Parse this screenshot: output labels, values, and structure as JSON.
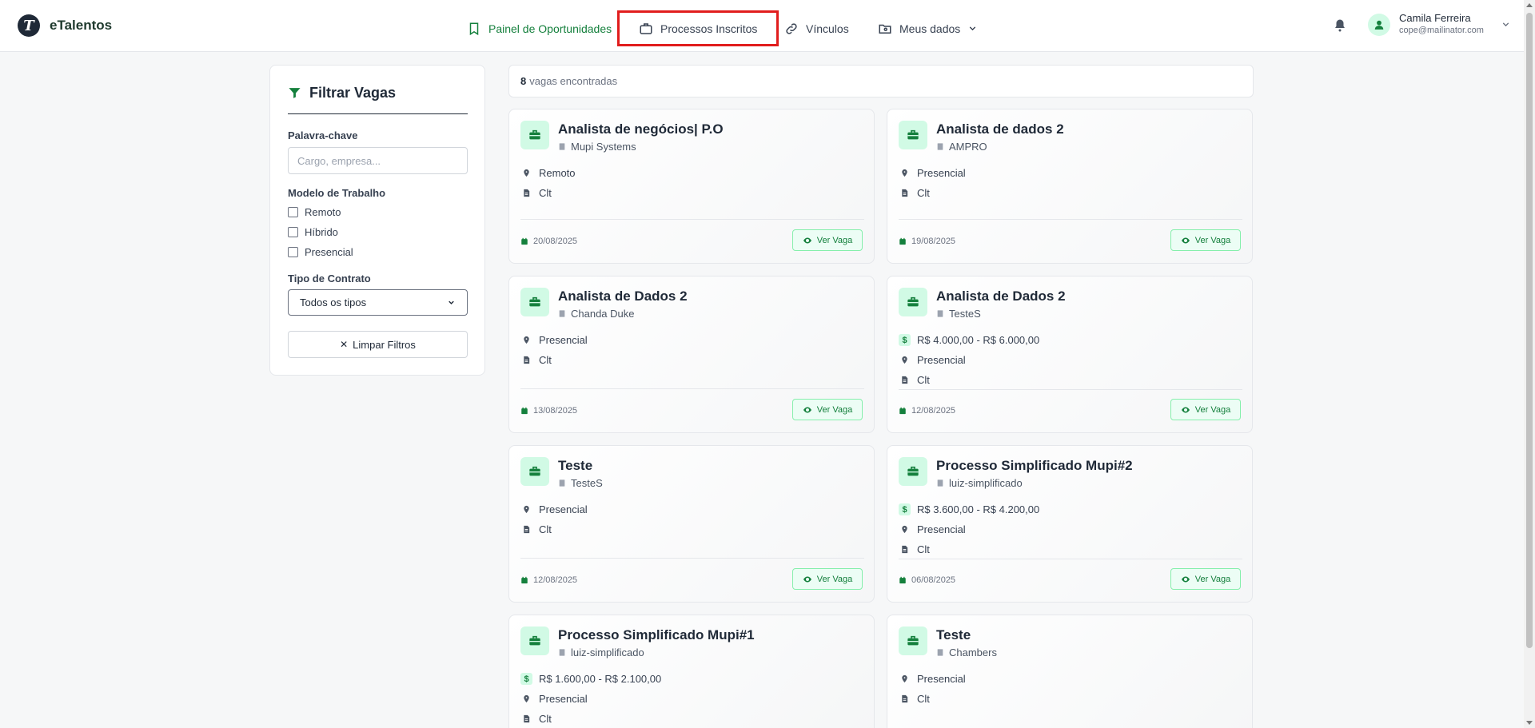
{
  "app": {
    "name": "eTalentos",
    "logo_letter": "T"
  },
  "nav": {
    "painel": "Painel de Oportunidades",
    "processos": "Processos Inscritos",
    "vinculos": "Vínculos",
    "meus_dados": "Meus dados"
  },
  "user": {
    "name": "Camila Ferreira",
    "email": "cope@mailinator.com"
  },
  "filter": {
    "title": "Filtrar Vagas",
    "keyword_label": "Palavra-chave",
    "keyword_placeholder": "Cargo, empresa...",
    "work_model_label": "Modelo de Trabalho",
    "work_models": [
      "Remoto",
      "Híbrido",
      "Presencial"
    ],
    "contract_label": "Tipo de Contrato",
    "contract_selected": "Todos os tipos",
    "clear_label": "Limpar Filtros"
  },
  "results": {
    "count": "8",
    "count_suffix": "vagas encontradas"
  },
  "jobs": [
    {
      "title": "Analista de negócios| P.O",
      "company": "Mupi Systems",
      "salary": "",
      "model": "Remoto",
      "contract": "Clt",
      "date": "20/08/2025",
      "button": "Ver Vaga"
    },
    {
      "title": "Analista de dados 2",
      "company": "AMPRO",
      "salary": "",
      "model": "Presencial",
      "contract": "Clt",
      "date": "19/08/2025",
      "button": "Ver Vaga"
    },
    {
      "title": "Analista de Dados 2",
      "company": "Chanda Duke",
      "salary": "",
      "model": "Presencial",
      "contract": "Clt",
      "date": "13/08/2025",
      "button": "Ver Vaga"
    },
    {
      "title": "Analista de Dados 2",
      "company": "TesteS",
      "salary": "R$ 4.000,00 - R$ 6.000,00",
      "model": "Presencial",
      "contract": "Clt",
      "date": "12/08/2025",
      "button": "Ver Vaga"
    },
    {
      "title": "Teste",
      "company": "TesteS",
      "salary": "",
      "model": "Presencial",
      "contract": "Clt",
      "date": "12/08/2025",
      "button": "Ver Vaga"
    },
    {
      "title": "Processo Simplificado Mupi#2",
      "company": "luiz-simplificado",
      "salary": "R$ 3.600,00 - R$ 4.200,00",
      "model": "Presencial",
      "contract": "Clt",
      "date": "06/08/2025",
      "button": "Ver Vaga"
    },
    {
      "title": "Processo Simplificado Mupi#1",
      "company": "luiz-simplificado",
      "salary": "R$ 1.600,00 - R$ 2.100,00",
      "model": "Presencial",
      "contract": "Clt",
      "date": "",
      "button": ""
    },
    {
      "title": "Teste",
      "company": "Chambers",
      "salary": "",
      "model": "Presencial",
      "contract": "Clt",
      "date": "",
      "button": ""
    }
  ],
  "colors": {
    "accent": "#15803d",
    "accent_light": "#d1fae5",
    "highlight": "#e11d1d"
  }
}
